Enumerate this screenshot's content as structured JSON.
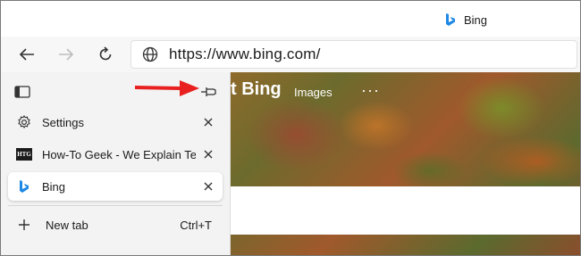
{
  "window": {
    "active_tab_title": "Bing"
  },
  "toolbar": {
    "back_icon": "arrow-left-icon",
    "forward_icon": "arrow-right-icon",
    "refresh_icon": "refresh-icon",
    "address": {
      "icon": "globe-icon",
      "url": "https://www.bing.com/"
    }
  },
  "vertical_tabs": {
    "toggle_icon": "pane-toggle-icon",
    "pin_icon": "pin-icon",
    "tabs": [
      {
        "label": "Settings",
        "icon": "gear-icon",
        "active": false
      },
      {
        "label": "How-To Geek - We Explain Technology",
        "icon": "htg-favicon",
        "favicon_text": "HTG",
        "active": false
      },
      {
        "label": "Bing",
        "icon": "bing-icon",
        "active": true
      }
    ],
    "new_tab": {
      "label": "New tab",
      "shortcut": "Ctrl+T"
    }
  },
  "page": {
    "title_fragment": "t Bing",
    "images_link": "Images",
    "more_label": "···"
  },
  "colors": {
    "arrow": "#e8201f",
    "bing_blue": "#1e88e5"
  }
}
